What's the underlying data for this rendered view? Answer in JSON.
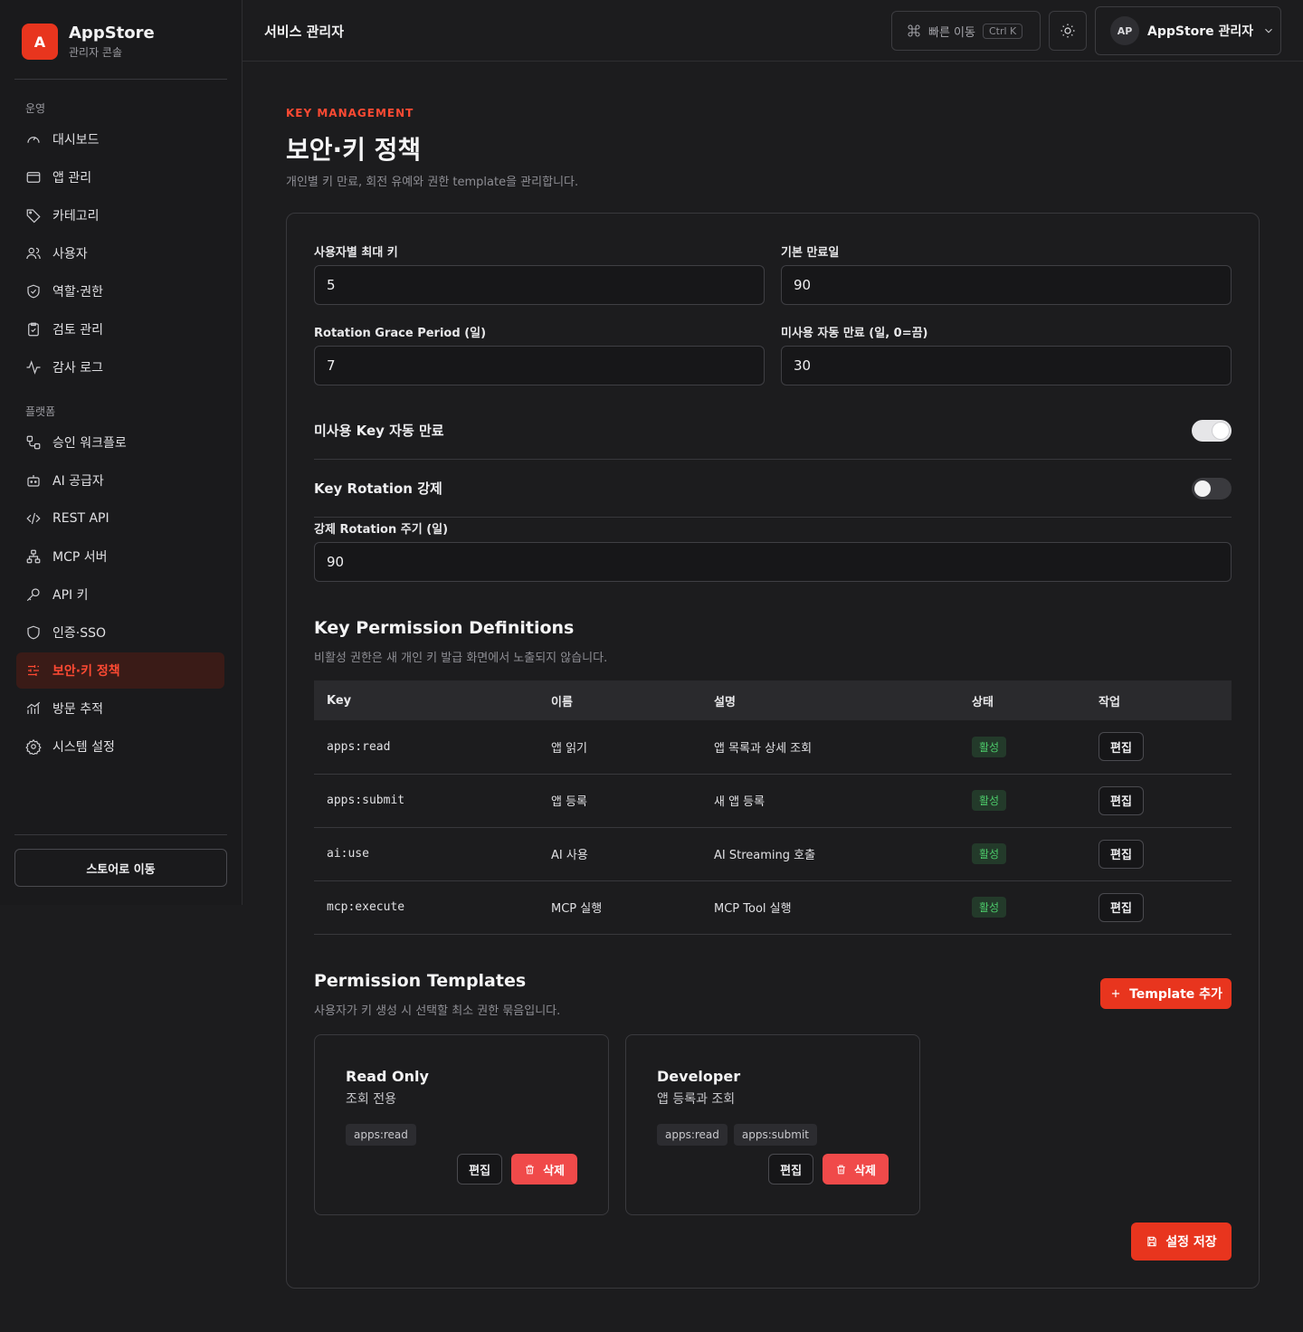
{
  "brand": {
    "logo_letter": "A",
    "name": "AppStore",
    "subtitle": "관리자 콘솔",
    "accent": "#e8351e"
  },
  "sidebar": {
    "sections": [
      {
        "label": "운영",
        "items": [
          {
            "label": "대시보드",
            "icon": "gauge-icon"
          },
          {
            "label": "앱 관리",
            "icon": "window-icon"
          },
          {
            "label": "카테고리",
            "icon": "tag-icon"
          },
          {
            "label": "사용자",
            "icon": "users-icon"
          },
          {
            "label": "역할·권한",
            "icon": "shield-check-icon"
          },
          {
            "label": "검토 관리",
            "icon": "clipboard-check-icon"
          },
          {
            "label": "감사 로그",
            "icon": "activity-icon"
          }
        ]
      },
      {
        "label": "플랫폼",
        "items": [
          {
            "label": "승인 워크플로",
            "icon": "workflow-icon"
          },
          {
            "label": "AI 공급자",
            "icon": "bot-icon"
          },
          {
            "label": "REST API",
            "icon": "code-icon"
          },
          {
            "label": "MCP 서버",
            "icon": "network-icon"
          },
          {
            "label": "API 키",
            "icon": "key-icon"
          },
          {
            "label": "인증·SSO",
            "icon": "shield-icon"
          },
          {
            "label": "보안·키 정책",
            "icon": "sliders-icon",
            "active": true
          },
          {
            "label": "방문 추적",
            "icon": "chart-icon"
          },
          {
            "label": "시스템 설정",
            "icon": "gear-icon"
          }
        ]
      }
    ],
    "store_button": "스토어로 이동"
  },
  "header": {
    "title": "서비스 관리자",
    "quick_nav": {
      "label": "빠른 이동",
      "shortcut": "Ctrl K"
    },
    "user": {
      "initials": "AP",
      "name": "AppStore 관리자"
    }
  },
  "page": {
    "eyebrow": "KEY MANAGEMENT",
    "title": "보안·키 정책",
    "description": "개인별 키 만료, 회전 유예와 권한 template을 관리합니다."
  },
  "form": {
    "max_keys": {
      "label": "사용자별 최대 키",
      "value": "5"
    },
    "default_expiry": {
      "label": "기본 만료일",
      "value": "90"
    },
    "grace_period": {
      "label": "Rotation Grace Period (일)",
      "value": "7"
    },
    "unused_expiry": {
      "label": "미사용 자동 만료 (일, 0=끔)",
      "value": "30"
    },
    "toggle_unused": {
      "label": "미사용 Key 자동 만료",
      "on": true
    },
    "toggle_rotation": {
      "label": "Key Rotation 강제",
      "on": false
    },
    "rotation_period": {
      "label": "강제 Rotation 주기 (일)",
      "value": "90"
    }
  },
  "permissions": {
    "title": "Key Permission Definitions",
    "description": "비활성 권한은 새 개인 키 발급 화면에서 노출되지 않습니다.",
    "columns": [
      "Key",
      "이름",
      "설명",
      "상태",
      "작업"
    ],
    "rows": [
      {
        "key": "apps:read",
        "name": "앱 읽기",
        "desc": "앱 목록과 상세 조회",
        "status": "활성",
        "action": "편집"
      },
      {
        "key": "apps:submit",
        "name": "앱 등록",
        "desc": "새 앱 등록",
        "status": "활성",
        "action": "편집"
      },
      {
        "key": "ai:use",
        "name": "AI 사용",
        "desc": "AI Streaming 호출",
        "status": "활성",
        "action": "편집"
      },
      {
        "key": "mcp:execute",
        "name": "MCP 실행",
        "desc": "MCP Tool 실행",
        "status": "활성",
        "action": "편집"
      }
    ]
  },
  "templates": {
    "title": "Permission Templates",
    "description": "사용자가 키 생성 시 선택할 최소 권한 묶음입니다.",
    "add_button": "Template 추가",
    "items": [
      {
        "name": "Read Only",
        "desc": "조회 전용",
        "chips": [
          "apps:read"
        ],
        "edit": "편집",
        "delete": "삭제"
      },
      {
        "name": "Developer",
        "desc": "앱 등록과 조회",
        "chips": [
          "apps:read",
          "apps:submit"
        ],
        "edit": "편집",
        "delete": "삭제"
      }
    ]
  },
  "save_button": "설정 저장"
}
